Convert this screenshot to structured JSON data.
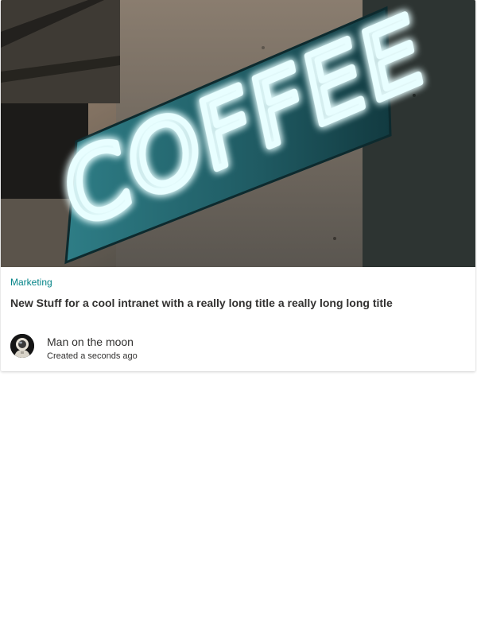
{
  "card": {
    "category": "Marketing",
    "title": "New Stuff for a cool intranet with a really long title a really long long title",
    "hero_image": {
      "sign_text": "COFFEE",
      "icon": "neon-coffee-sign-image"
    },
    "author": {
      "name": "Man on the moon",
      "created": "Created a seconds ago",
      "avatar_icon": "astronaut-avatar"
    }
  },
  "colors": {
    "category": "#038387",
    "text": "#323130",
    "neon": "#e6fdff",
    "neon_glow": "#5fd8e8",
    "panel": "#2a6c74"
  }
}
